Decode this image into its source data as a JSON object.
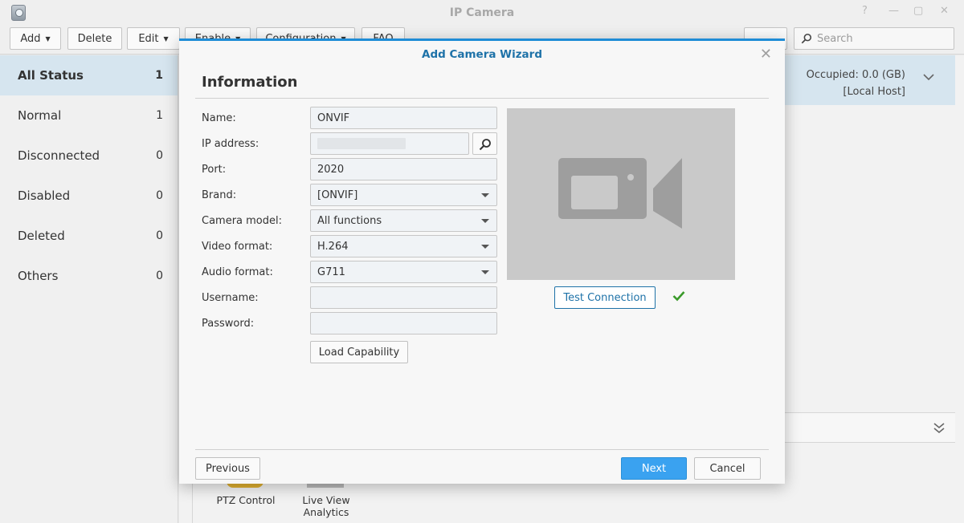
{
  "app": {
    "title": "IP Camera"
  },
  "toolbar": {
    "add": "Add",
    "delete": "Delete",
    "edit": "Edit",
    "enable": "Enable",
    "configuration": "Configuration",
    "faq": "FAQ",
    "search_placeholder": "Search"
  },
  "sidebar": {
    "items": [
      {
        "label": "All Status",
        "count": "1"
      },
      {
        "label": "Normal",
        "count": "1"
      },
      {
        "label": "Disconnected",
        "count": "0"
      },
      {
        "label": "Disabled",
        "count": "0"
      },
      {
        "label": "Deleted",
        "count": "0"
      },
      {
        "label": "Others",
        "count": "0"
      }
    ]
  },
  "main": {
    "occupied": "Occupied: 0.0 (GB)",
    "host": "[Local Host]",
    "tools": [
      {
        "label": "PTZ Control"
      },
      {
        "label": "Live View Analytics"
      }
    ]
  },
  "wizard": {
    "title": "Add Camera Wizard",
    "section": "Information",
    "fields": {
      "name": {
        "label": "Name:",
        "value": "ONVIF"
      },
      "ip": {
        "label": "IP address:",
        "value": ""
      },
      "port": {
        "label": "Port:",
        "value": "2020"
      },
      "brand": {
        "label": "Brand:",
        "value": "[ONVIF]"
      },
      "model": {
        "label": "Camera model:",
        "value": "All functions"
      },
      "video": {
        "label": "Video format:",
        "value": "H.264"
      },
      "audio": {
        "label": "Audio format:",
        "value": "G711"
      },
      "username": {
        "label": "Username:",
        "value": ""
      },
      "password": {
        "label": "Password:",
        "value": ""
      }
    },
    "load_capability": "Load Capability",
    "test_connection": "Test Connection",
    "test_status": "success",
    "previous": "Previous",
    "next": "Next",
    "cancel": "Cancel"
  },
  "colors": {
    "accent": "#1e8cd6",
    "title_blue": "#1e72a8",
    "primary_button": "#3aa2f0",
    "selected_row": "#d6e5ef",
    "success": "#3a9a2a"
  }
}
